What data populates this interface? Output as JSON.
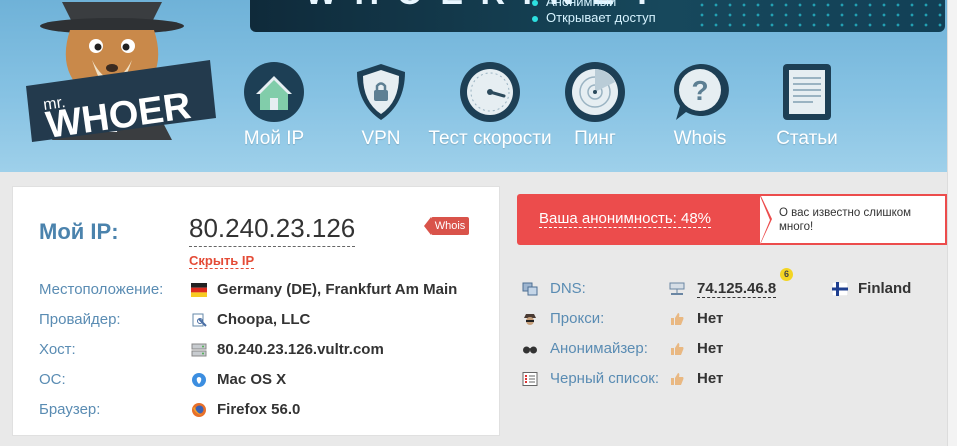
{
  "banner": {
    "big_text": "W H O E R . N E T",
    "line1": "Анонимный",
    "line2": "Открывает доступ"
  },
  "logo": {
    "prefix": "mr.",
    "name": "WHOER"
  },
  "nav": [
    {
      "label": "Мой IP",
      "icon": "home-icon"
    },
    {
      "label": "VPN",
      "icon": "shield-lock-icon"
    },
    {
      "label": "Тест скорости",
      "icon": "speedometer-icon"
    },
    {
      "label": "Пинг",
      "icon": "radar-icon"
    },
    {
      "label": "Whois",
      "icon": "question-bubble-icon"
    },
    {
      "label": "Статьи",
      "icon": "document-icon"
    }
  ],
  "ip_card": {
    "label": "Мой IP:",
    "ip": "80.240.23.126",
    "hide_ip": "Скрыть IP",
    "whois": "Whois",
    "rows": [
      {
        "label": "Местоположение:",
        "value": "Germany (DE), Frankfurt Am Main",
        "icon": "germany-flag-icon"
      },
      {
        "label": "Провайдер:",
        "value": "Choopa, LLC",
        "icon": "provider-icon"
      },
      {
        "label": "Хост:",
        "value": "80.240.23.126.vultr.com",
        "icon": "server-icon"
      },
      {
        "label": "ОС:",
        "value": "Mac OS X",
        "icon": "apple-icon"
      },
      {
        "label": "Браузер:",
        "value": "Firefox 56.0",
        "icon": "firefox-icon"
      }
    ]
  },
  "anonymity": {
    "text": "Ваша анонимность: 48%",
    "note": "О вас известно слишком много!"
  },
  "checks": {
    "dns": {
      "label": "DNS:",
      "value": "74.125.46.8",
      "count": "6",
      "country": "Finland"
    },
    "rows": [
      {
        "label": "Прокси:",
        "value": "Нет",
        "icon": "spy-icon"
      },
      {
        "label": "Анонимайзер:",
        "value": "Нет",
        "icon": "glasses-icon"
      },
      {
        "label": "Черный список:",
        "value": "Нет",
        "icon": "list-icon"
      }
    ]
  },
  "colors": {
    "accent_blue": "#4b83ad",
    "alert_red": "#ec4c4c",
    "header_blue": "#86c2e3"
  }
}
